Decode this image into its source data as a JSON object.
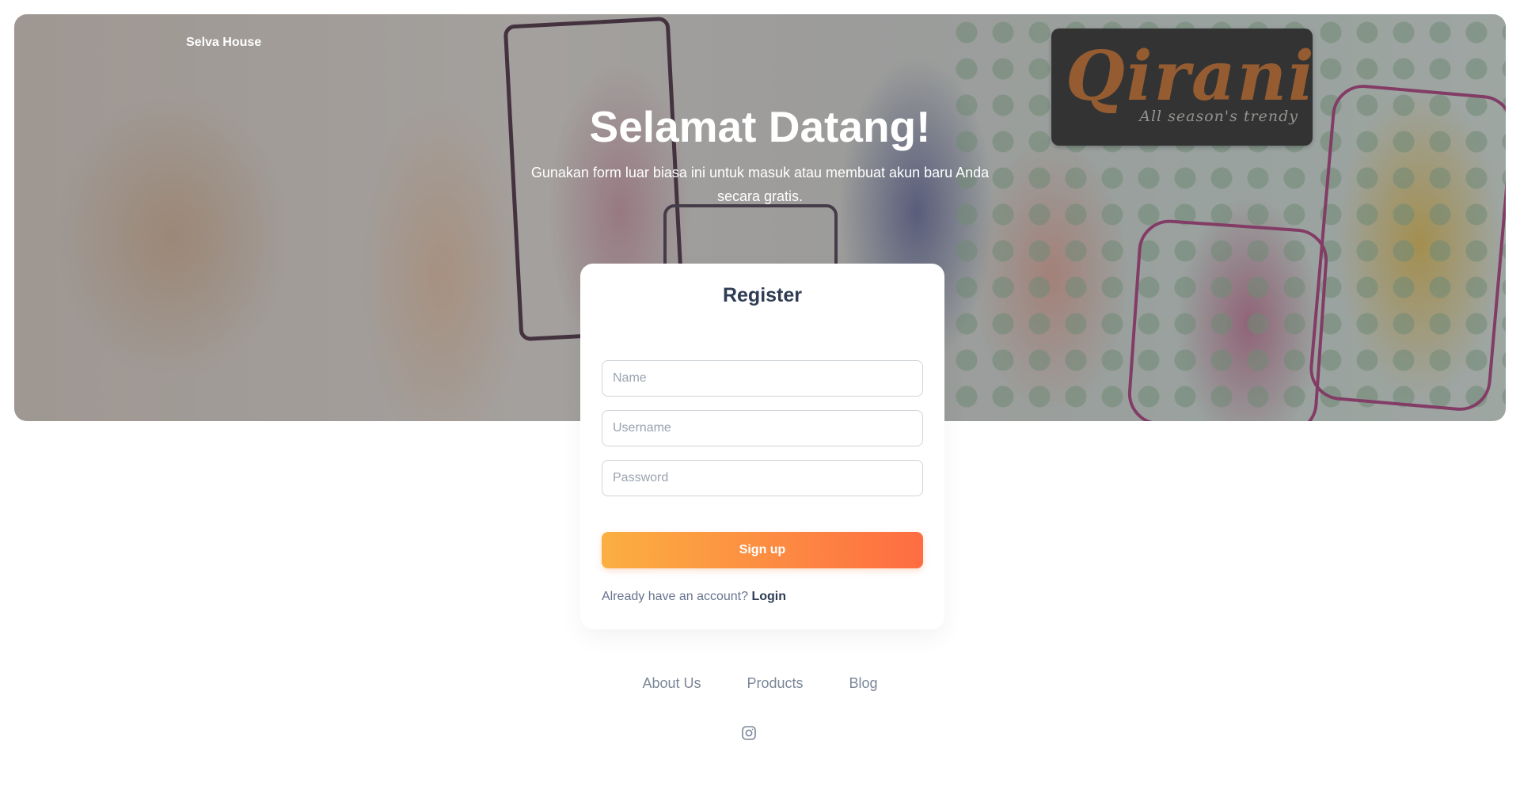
{
  "hero": {
    "brand": "Selva House",
    "title": "Selamat Datang!",
    "subtitle": "Gunakan form luar biasa ini untuk masuk atau membuat akun baru Anda secara gratis.",
    "photo_logo_main": "Qirani",
    "photo_logo_tagline": "All season's trendy"
  },
  "register": {
    "title": "Register",
    "name_placeholder": "Name",
    "username_placeholder": "Username",
    "password_placeholder": "Password",
    "signup_label": "Sign up",
    "account_prompt": "Already have an account?",
    "login_label": "Login"
  },
  "footer": {
    "links": [
      "About Us",
      "Products",
      "Blog"
    ],
    "social_icon": "instagram-icon"
  },
  "colors": {
    "accent_start": "#fbaf41",
    "accent_end": "#fe6d42",
    "heading": "#2f3c54",
    "muted": "#7b8698"
  }
}
